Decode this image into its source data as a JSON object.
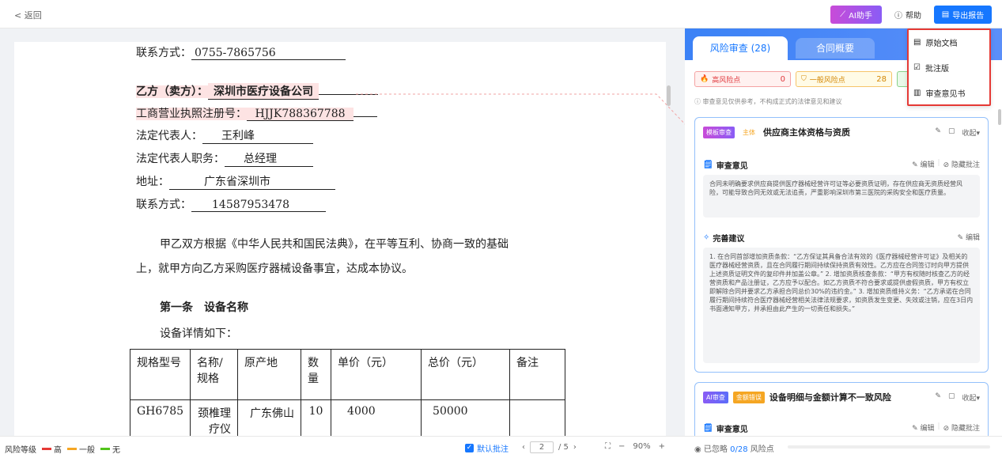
{
  "topbar": {
    "back_label": "< 返回",
    "ai_label": "AI助手",
    "help_label": "帮助",
    "export_label": "导出报告"
  },
  "dropdown": {
    "items": [
      "原始文档",
      "批注版",
      "审查意见书"
    ]
  },
  "doc": {
    "lines": {
      "contact1_label": "联系方式：",
      "contact1_value": "0755-7865756",
      "partyb_label": "乙方（卖方）：",
      "partyb_value": "深圳市医疗设备公司",
      "license_label": "工商营业执照注册号：",
      "license_value": "HJJK788367788",
      "legal_label": "法定代表人：",
      "legal_value": "王利峰",
      "title_label": "法定代表人职务：",
      "title_value": "总经理",
      "addr_label": "地址：",
      "addr_value": "广东省深圳市",
      "contact2_label": "联系方式：",
      "contact2_value": "14587953478",
      "para1": "甲乙双方根据《中华人民共和国民法典》，在平等互利、协商一致的基础",
      "para2": "上，就甲方向乙方采购医疗器械设备事宜，达成本协议。",
      "article1": "第一条　设备名称",
      "detail": "设备详情如下："
    },
    "table": {
      "headers": [
        "规格型号",
        "名称/规格",
        "原产地",
        "数量",
        "单价（元）",
        "总价（元）",
        "备注"
      ],
      "row1": [
        "GH6785",
        "颈椎理疗仪",
        "广东佛山",
        "10",
        "4000",
        "50000",
        ""
      ]
    }
  },
  "bottombar": {
    "legend_label": "风险等级",
    "legend_high": "高",
    "legend_mid": "一般",
    "legend_none": "无",
    "default_annot": "默认批注",
    "page_current": "2",
    "page_total": "/ 5",
    "zoom": "90%"
  },
  "panel": {
    "tab_active": "风险审查 (28)",
    "tab2": "合同概要",
    "risk_high_label": "高风险点",
    "risk_high_count": "0",
    "risk_mid_label": "一般风险点",
    "risk_mid_count": "28",
    "notice": "审查意见仅供参考，不构成正式的法律意见和建议",
    "card1": {
      "tag1": "模板审查",
      "tag2": "主体",
      "title": "供应商主体资格与资质",
      "collapse": "收起",
      "opinion_head": "审查意见",
      "edit": "编辑",
      "hide": "隐藏批注",
      "opinion": "合同未明确要求供应商提供医疗器械经营许可证等必要资质证明，存在供应商无资质经营风险，可能导致合同无效或无法追责，严重影响深圳市第三医院的采购安全和医疗质量。",
      "suggest_head": "完善建议",
      "suggest": "1. 在合同首部增加资质条款：“乙方保证其具备合法有效的《医疗器械经营许可证》及相关的医疗器械经营资质，且在合同履行期间持续保持资质有效性。乙方应在合同签订时向甲方提供上述资质证明文件的复印件并加盖公章。” 2. 增加资质核查条款：“甲方有权随时核查乙方的经营资质和产品注册证，乙方应予以配合。如乙方资质不符合要求或提供虚假资质，甲方有权立即解除合同并要求乙方承担合同总价30%的违约金。” 3. 增加资质维持义务：“乙方承诺在合同履行期间持续符合医疗器械经营相关法律法规要求，如资质发生变更、失效或注销，应在3日内书面通知甲方，并承担由此产生的一切责任和损失。”"
    },
    "card2": {
      "tag1": "AI审查",
      "tag2": "金额错误",
      "title": "设备明细与金额计算不一致风险",
      "collapse": "收起",
      "opinion_head": "审查意见",
      "edit": "编辑",
      "hide": "隐藏批注"
    },
    "bottom_prefix": "已忽略",
    "bottom_count": "0/28",
    "bottom_suffix": "风险点"
  },
  "colors": {
    "accent": "#1677ff",
    "high": "#e53935",
    "mid": "#f5a623",
    "none": "#52c41a"
  }
}
